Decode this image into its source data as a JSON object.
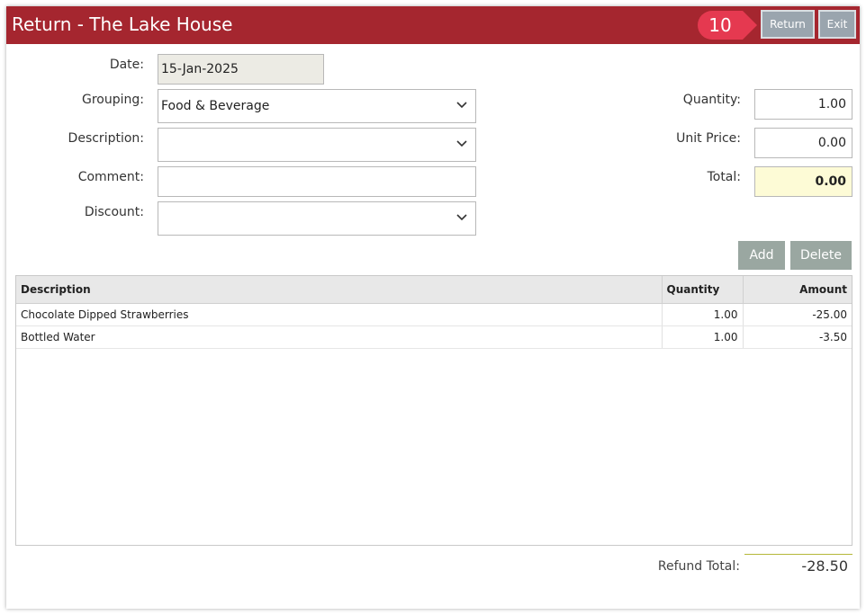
{
  "window": {
    "title": "Return - The Lake House",
    "step_number": "10",
    "buttons": {
      "return": "Return",
      "exit": "Exit"
    }
  },
  "form": {
    "date": {
      "label": "Date:",
      "value": "15-Jan-2025"
    },
    "grouping": {
      "label": "Grouping:",
      "value": "Food & Beverage"
    },
    "description": {
      "label": "Description:",
      "value": ""
    },
    "comment": {
      "label": "Comment:",
      "value": ""
    },
    "discount": {
      "label": "Discount:",
      "value": ""
    },
    "quantity": {
      "label": "Quantity:",
      "value": "1.00"
    },
    "unit_price": {
      "label": "Unit Price:",
      "value": "0.00"
    },
    "total": {
      "label": "Total:",
      "value": "0.00"
    }
  },
  "actions": {
    "add": "Add",
    "delete": "Delete"
  },
  "table": {
    "headers": {
      "description": "Description",
      "quantity": "Quantity",
      "amount": "Amount"
    },
    "rows": [
      {
        "description": "Chocolate Dipped Strawberries",
        "quantity": "1.00",
        "amount": "-25.00"
      },
      {
        "description": "Bottled Water",
        "quantity": "1.00",
        "amount": "-3.50"
      }
    ]
  },
  "summary": {
    "refund_label": "Refund Total:",
    "refund_value": "-28.50"
  },
  "colors": {
    "titlebar": "#a5262f",
    "badge": "#e53950",
    "button": "#9aa5ae",
    "total_bg": "#fdfbd6"
  }
}
